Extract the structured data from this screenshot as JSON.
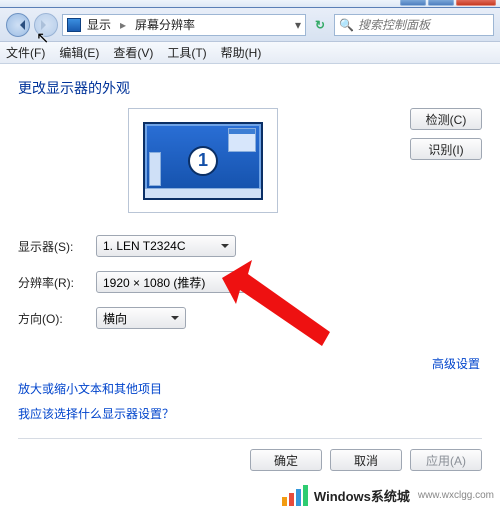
{
  "window": {
    "min": "–",
    "max": "□",
    "close": "×"
  },
  "address": {
    "crumb1": "显示",
    "crumb2": "屏幕分辨率",
    "search_placeholder": "搜索控制面板"
  },
  "menu": {
    "file": "文件(F)",
    "edit": "编辑(E)",
    "view": "查看(V)",
    "tools": "工具(T)",
    "help": "帮助(H)"
  },
  "heading": "更改显示器的外观",
  "preview": {
    "display_number": "1"
  },
  "buttons": {
    "detect": "检测(C)",
    "identify": "识别(I)",
    "ok": "确定",
    "cancel": "取消",
    "apply": "应用(A)"
  },
  "form": {
    "display_label": "显示器(S):",
    "display_value": "1. LEN T2324C",
    "resolution_label": "分辨率(R):",
    "resolution_value": "1920 × 1080 (推荐)",
    "orientation_label": "方向(O):",
    "orientation_value": "横向"
  },
  "links": {
    "advanced": "高级设置",
    "textsize": "放大或缩小文本和其他项目",
    "whichdisplay": "我应该选择什么显示器设置？"
  },
  "watermark": {
    "brand": "Windows系统城",
    "url": "www.wxclgg.com"
  }
}
